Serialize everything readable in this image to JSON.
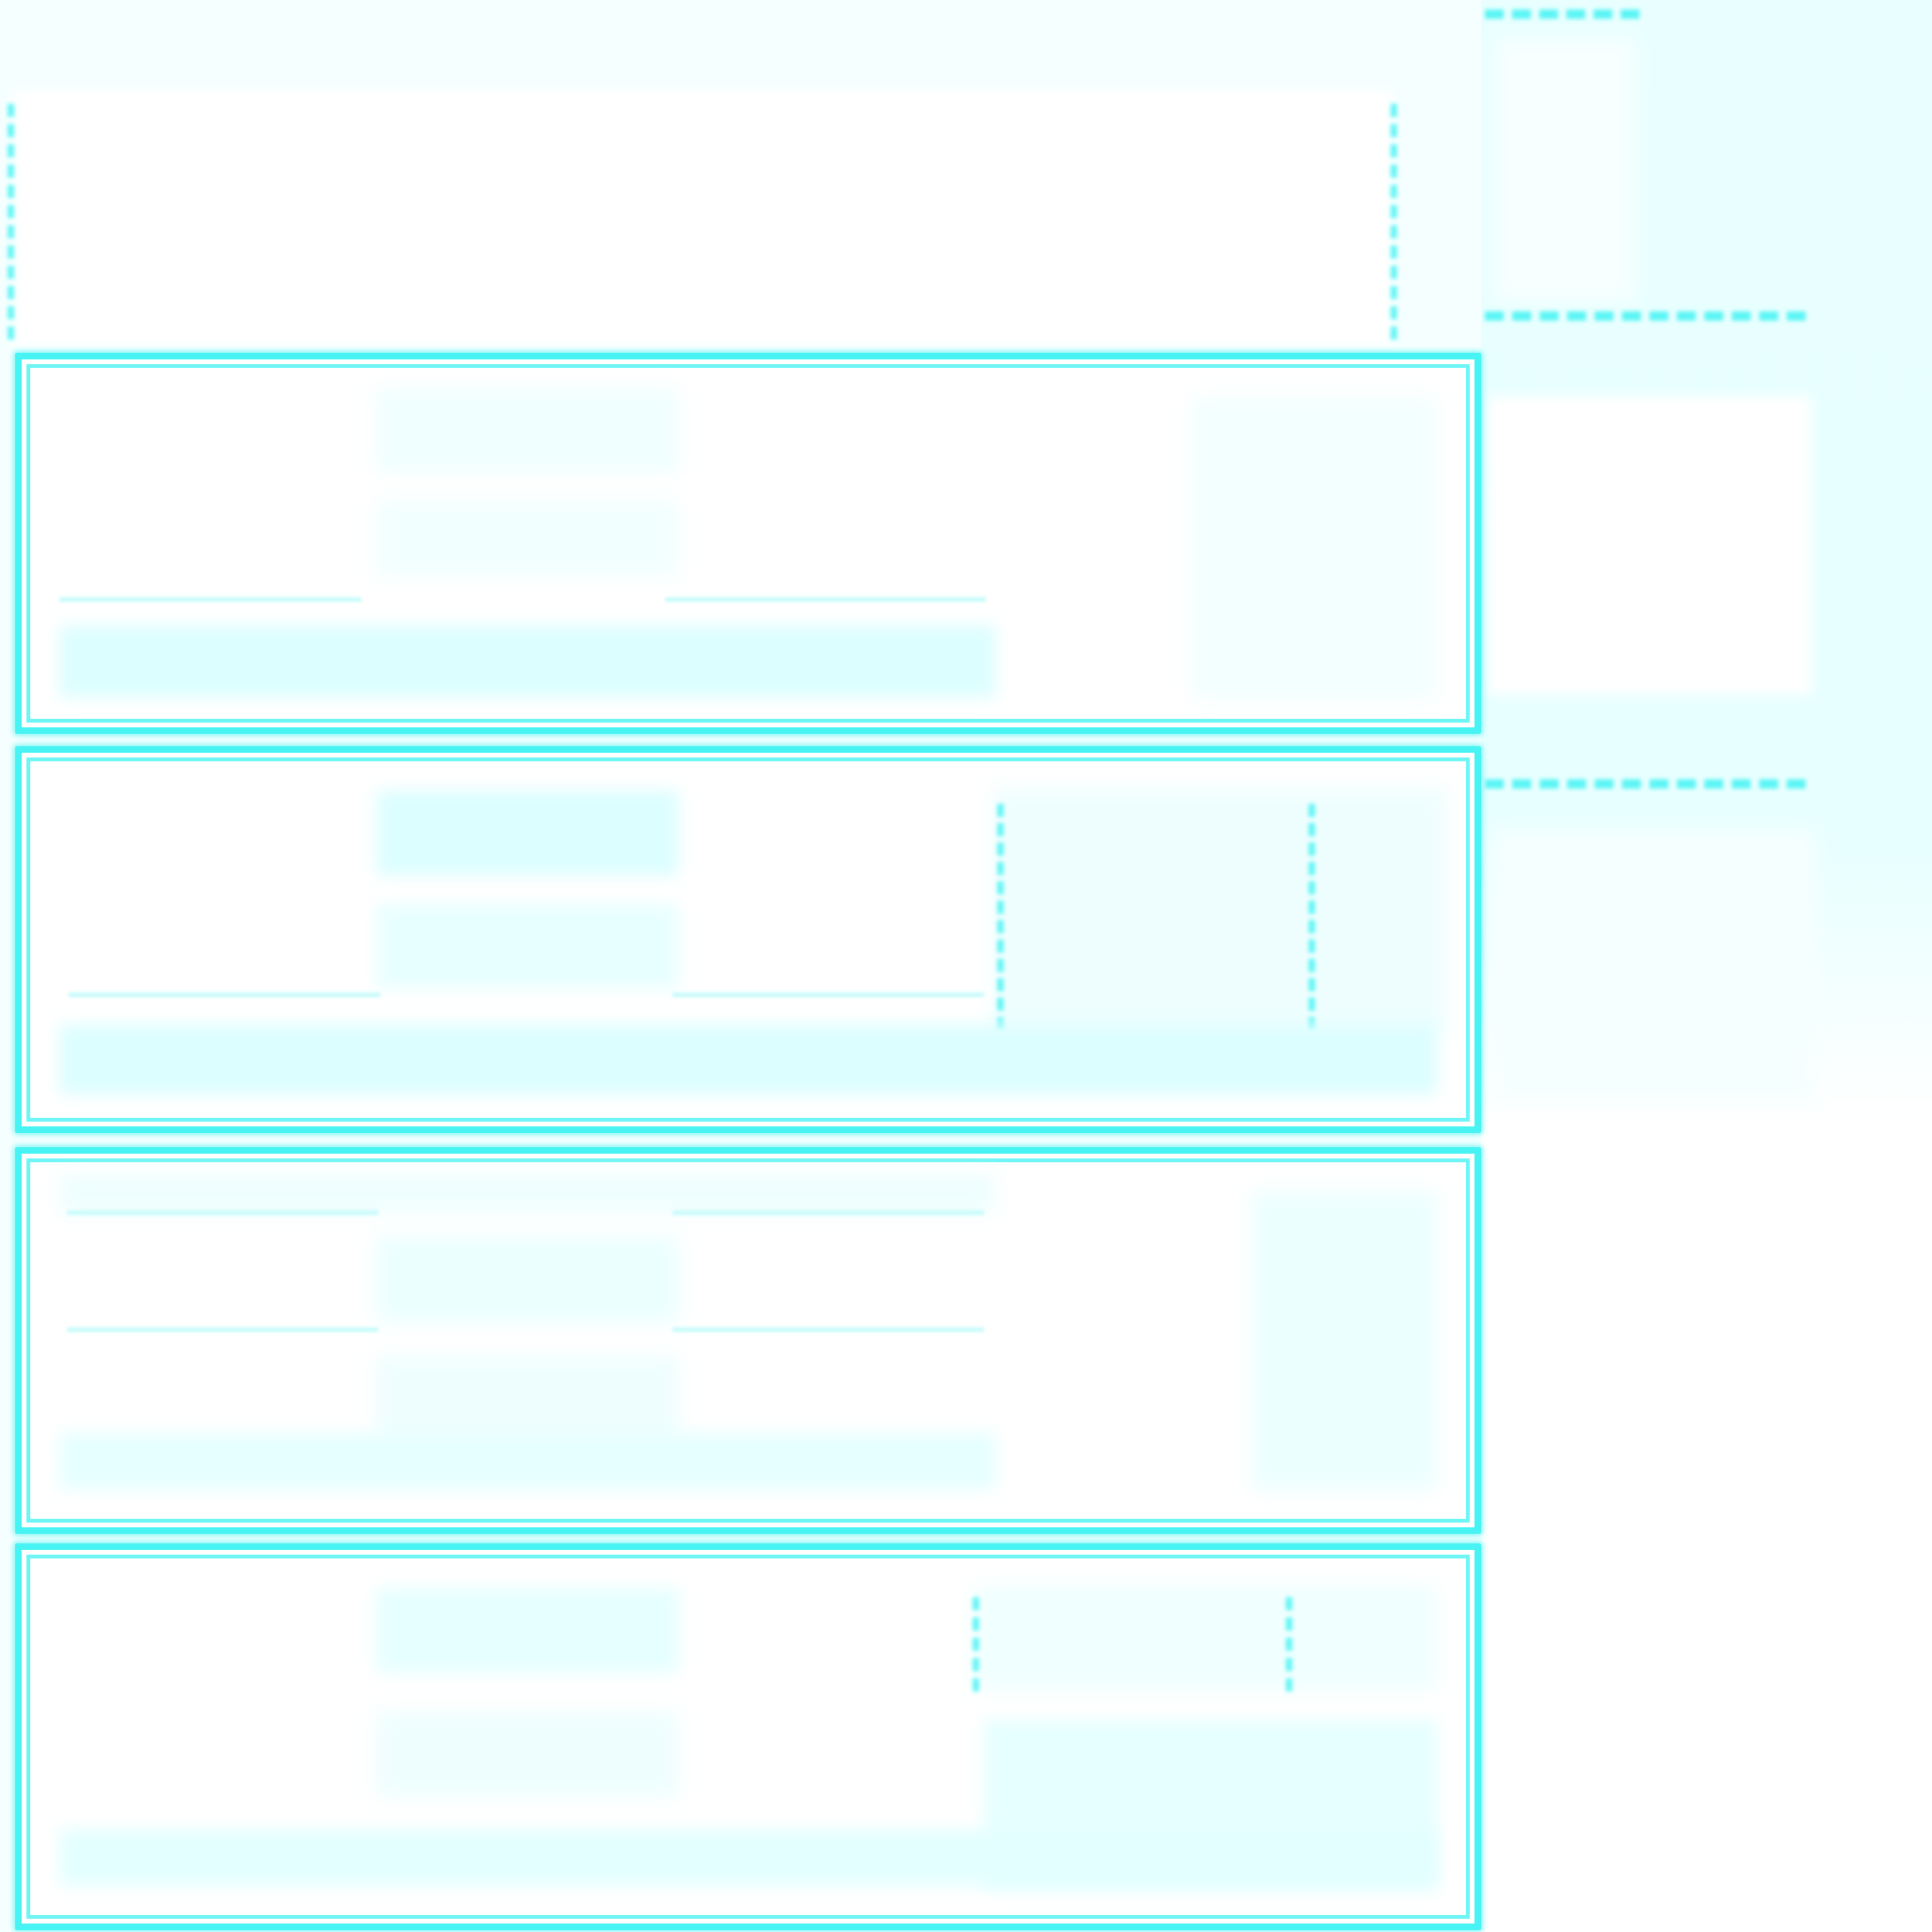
{
  "screen": {
    "background": "#f6ffff",
    "accent": "#4ef4f4",
    "accent_soft": "#dcfeff"
  },
  "header": {
    "title": "",
    "subtitle": ""
  },
  "cards": [
    {
      "title": "",
      "status": ""
    },
    {
      "title": "",
      "status": ""
    },
    {
      "title": "",
      "status": ""
    },
    {
      "title": "",
      "status": ""
    }
  ],
  "sidebar": {
    "section_1_label": "",
    "section_2_label": "",
    "section_3_label": ""
  }
}
